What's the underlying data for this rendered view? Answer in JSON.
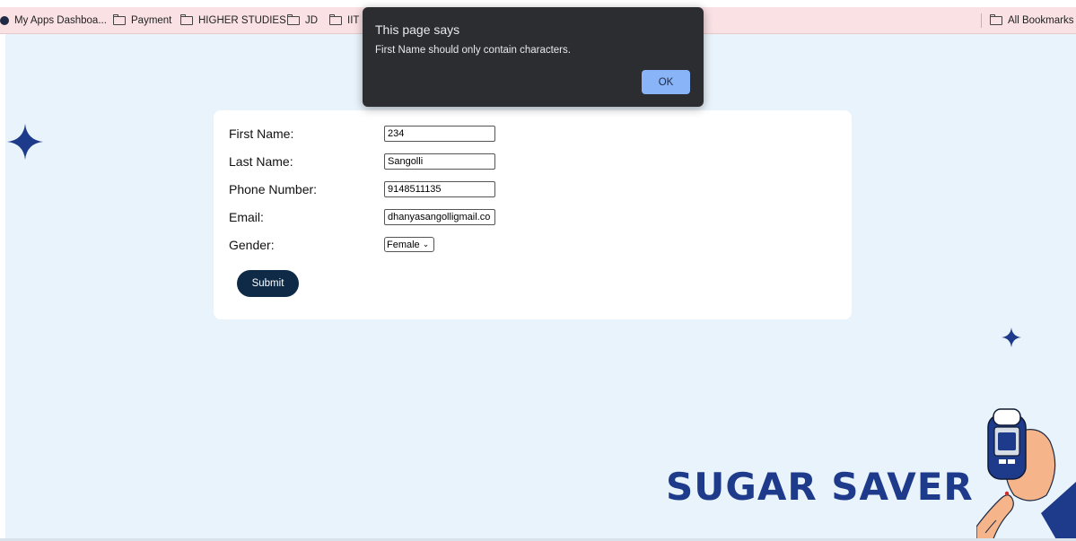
{
  "bookmarks": {
    "items": [
      {
        "label": "My Apps Dashboa..."
      },
      {
        "label": "Payment"
      },
      {
        "label": "HIGHER STUDIES"
      },
      {
        "label": "JD"
      },
      {
        "label": "IIT"
      }
    ],
    "all_bookmarks": "All Bookmarks"
  },
  "dialog": {
    "title": "This page says",
    "message": "First Name should only contain characters.",
    "ok_label": "OK"
  },
  "form": {
    "first_name": {
      "label": "First Name:",
      "value": "234"
    },
    "last_name": {
      "label": "Last Name:",
      "value": "Sangolli"
    },
    "phone": {
      "label": "Phone Number:",
      "value": "9148511135"
    },
    "email": {
      "label": "Email:",
      "value": "dhanyasangolligmail.co"
    },
    "gender": {
      "label": "Gender:",
      "selected": "Female"
    },
    "submit_label": "Submit"
  },
  "brand": {
    "name": "SUGAR SAVER"
  },
  "colors": {
    "brand": "#1e3a8a",
    "button": "#0f2a47",
    "background": "#e9f3fb",
    "dialog_ok": "#8ab4f8"
  }
}
